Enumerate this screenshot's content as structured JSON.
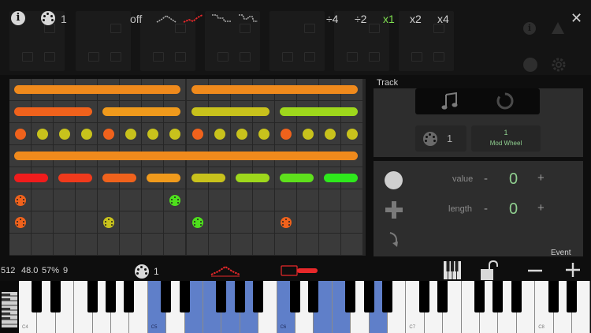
{
  "top_bar": {
    "channel": "1",
    "curve_off_label": "off",
    "speeds": [
      "÷4",
      "÷2",
      "x1",
      "x2",
      "x4"
    ],
    "active_speed": "x1",
    "close_label": "✕"
  },
  "grid": {
    "rows": [
      {
        "type": "bars",
        "items": [
          {
            "start": 0,
            "span": 8,
            "color": "#f08a1c"
          },
          {
            "start": 8,
            "span": 8,
            "color": "#f08a1c"
          }
        ]
      },
      {
        "type": "bars",
        "items": [
          {
            "start": 0,
            "span": 4,
            "color": "#f0621c"
          },
          {
            "start": 4,
            "span": 4,
            "color": "#f09a1c"
          },
          {
            "start": 8,
            "span": 4,
            "color": "#c8c21c"
          },
          {
            "start": 12,
            "span": 4,
            "color": "#9ed81c"
          }
        ]
      },
      {
        "type": "dots",
        "items": [
          {
            "col": 0,
            "color": "#f0621c"
          },
          {
            "col": 1,
            "color": "#c8c21c"
          },
          {
            "col": 2,
            "color": "#c8c21c"
          },
          {
            "col": 3,
            "color": "#c8c21c"
          },
          {
            "col": 4,
            "color": "#f0621c"
          },
          {
            "col": 5,
            "color": "#c8c21c"
          },
          {
            "col": 6,
            "color": "#c8c21c"
          },
          {
            "col": 7,
            "color": "#c8c21c"
          },
          {
            "col": 8,
            "color": "#f0621c"
          },
          {
            "col": 9,
            "color": "#c8c21c"
          },
          {
            "col": 10,
            "color": "#c8c21c"
          },
          {
            "col": 11,
            "color": "#c8c21c"
          },
          {
            "col": 12,
            "color": "#f0621c"
          },
          {
            "col": 13,
            "color": "#c8c21c"
          },
          {
            "col": 14,
            "color": "#c8c21c"
          },
          {
            "col": 15,
            "color": "#c8c21c"
          }
        ]
      },
      {
        "type": "bars",
        "items": [
          {
            "start": 0,
            "span": 16,
            "color": "#f08a1c"
          }
        ]
      },
      {
        "type": "bars",
        "items": [
          {
            "start": 0,
            "span": 2,
            "color": "#f01c1c"
          },
          {
            "start": 2,
            "span": 2,
            "color": "#f03a1c"
          },
          {
            "start": 4,
            "span": 2,
            "color": "#f0621c"
          },
          {
            "start": 6,
            "span": 2,
            "color": "#f09a1c"
          },
          {
            "start": 8,
            "span": 2,
            "color": "#c8c21c"
          },
          {
            "start": 10,
            "span": 2,
            "color": "#9ed81c"
          },
          {
            "start": 12,
            "span": 2,
            "color": "#5ee01c"
          },
          {
            "start": 14,
            "span": 2,
            "color": "#2ee81c"
          }
        ]
      },
      {
        "type": "midi",
        "items": [
          {
            "col": 0,
            "color": "#f0621c"
          },
          {
            "col": 7,
            "color": "#4ee01c"
          }
        ]
      },
      {
        "type": "midi",
        "items": [
          {
            "col": 0,
            "color": "#f0621c"
          },
          {
            "col": 4,
            "color": "#c8c21c"
          },
          {
            "col": 8,
            "color": "#4ee01c"
          },
          {
            "col": 12,
            "color": "#f0621c"
          }
        ]
      },
      {
        "type": "empty",
        "items": []
      }
    ]
  },
  "panel": {
    "track_tab": "Track",
    "channel": "1",
    "cc_number": "1",
    "cc_name": "Mod Wheel",
    "value_label": "value",
    "value": "0",
    "length_label": "length",
    "length": "0",
    "minus": "-",
    "plus": "+",
    "event_tab": "Event"
  },
  "status": {
    "steps": "512",
    "tempo": "48.0",
    "swing": "57%",
    "count": "9",
    "channel": "1"
  },
  "keyboard": {
    "octave_labels": [
      "C4",
      "C5",
      "C6",
      "C7",
      "C8"
    ],
    "highlight_color": "#5f7fc9"
  },
  "colors": {
    "accent_green": "#7fe050",
    "red_curve": "#e8282a"
  }
}
